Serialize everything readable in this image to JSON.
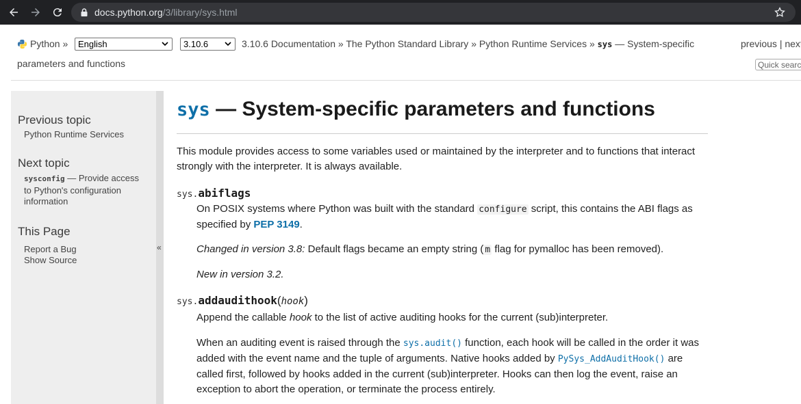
{
  "browser": {
    "url_host": "docs.python.org",
    "url_path": "/3/library/sys.html"
  },
  "related": {
    "python_label": "Python",
    "sep": "»",
    "language": "English",
    "version": "3.10.6",
    "breadcrumbs": [
      "3.10.6 Documentation",
      "The Python Standard Library",
      "Python Runtime Services"
    ],
    "current_code": "sys",
    "current_tail_1": " — System-specific",
    "current_tail_2": "parameters and functions",
    "previous": "previous",
    "pipe": "|",
    "next": "next",
    "search_placeholder": "Quick search"
  },
  "sidebar": {
    "prev_heading": "Previous topic",
    "prev_link": "Python Runtime Services",
    "next_heading": "Next topic",
    "next_code": "sysconfig",
    "next_text_1": " — Provide access",
    "next_text_2": "to Python's configuration",
    "next_text_3": "information",
    "this_page_heading": "This Page",
    "report_bug": "Report a Bug",
    "show_source": "Show Source",
    "collapse_glyph": "«"
  },
  "content": {
    "title_code": "sys",
    "title_rest": " — System-specific parameters and functions",
    "intro": "This module provides access to some variables used or maintained by the interpreter and to functions that interact strongly with the interpreter. It is always available.",
    "abiflags": {
      "prefix": "sys.",
      "name": "abiflags",
      "desc_1": "On POSIX systems where Python was built with the standard ",
      "desc_code": "configure",
      "desc_2": " script, this contains the ABI flags as specified by ",
      "pep": "PEP 3149",
      "desc_3": ".",
      "changed_label": "Changed in version 3.8:",
      "changed_1": " Default flags became an empty string (",
      "changed_code": "m",
      "changed_2": " flag for pymalloc has been removed).",
      "new_label": "New in version 3.2."
    },
    "addaudithook": {
      "prefix": "sys.",
      "name": "addaudithook",
      "open": "(",
      "param": "hook",
      "close": ")",
      "desc_1": "Append the callable ",
      "desc_em": "hook",
      "desc_2": " to the list of active auditing hooks for the current (sub)interpreter.",
      "p2_1": "When an auditing event is raised through the ",
      "p2_code1": "sys.audit()",
      "p2_2": " function, each hook will be called in the order it was added with the event name and the tuple of arguments. Native hooks added by ",
      "p2_code2": "PySys_AddAuditHook()",
      "p2_3": " are called first, followed by hooks added in the current (sub)interpreter. Hooks can then log the event, raise an exception to abort the operation, or terminate the process entirely."
    }
  }
}
